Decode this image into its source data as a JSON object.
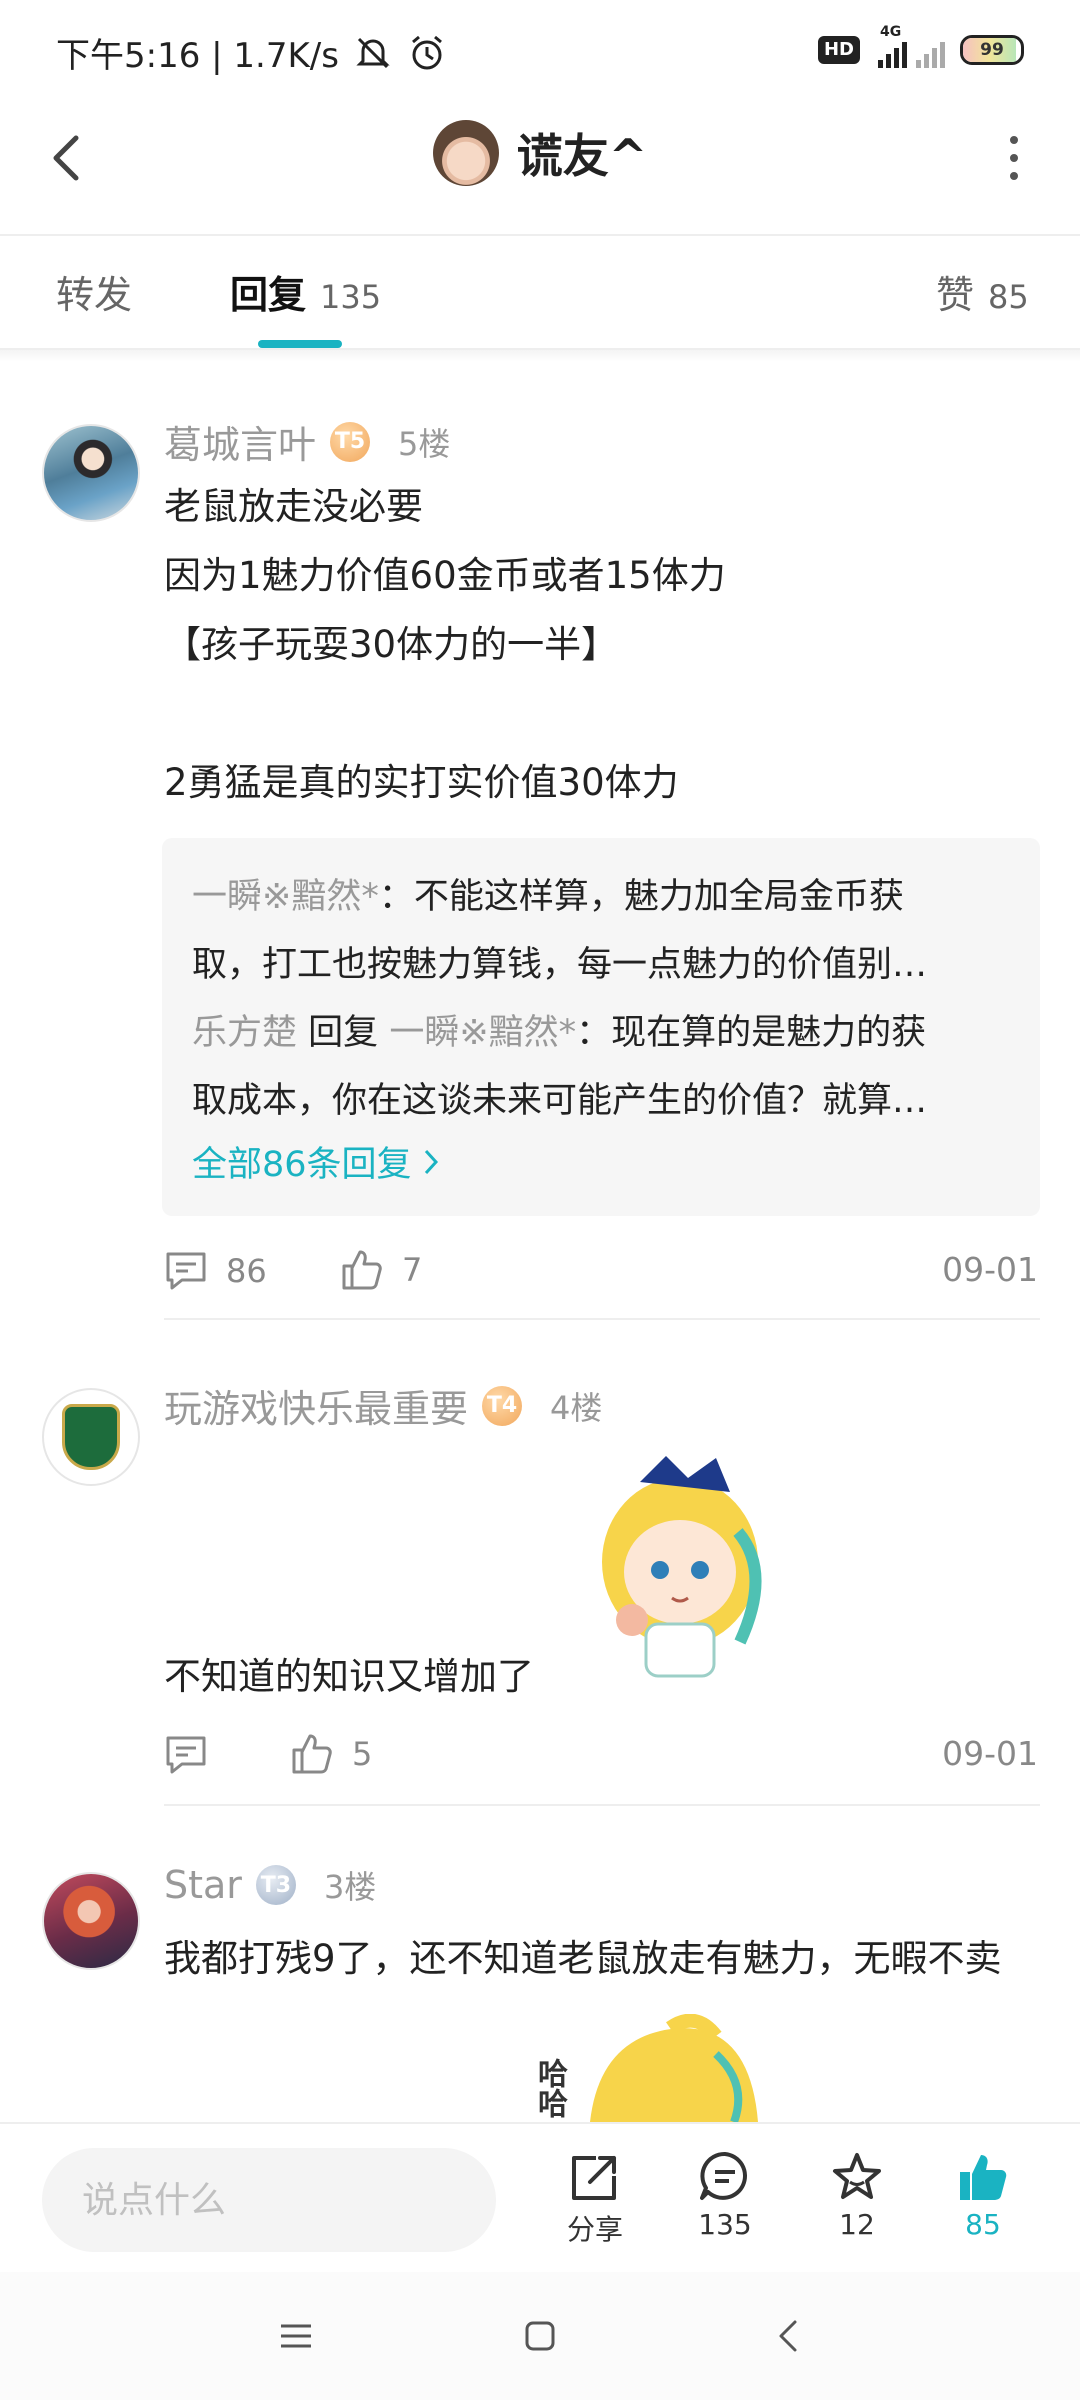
{
  "status_bar": {
    "time_speed": "下午5:16 | 1.7K/s",
    "hd": "HD",
    "network": "4G",
    "battery": "99"
  },
  "header": {
    "title": "谎友^"
  },
  "tabs": {
    "forward": "转发",
    "reply": "回复",
    "reply_count": "135",
    "like": "赞",
    "like_count": "85"
  },
  "posts": [
    {
      "username": "葛城言叶",
      "level": "T5",
      "floor": "5楼",
      "lines": [
        "老鼠放走没必要",
        "因为1魅力价值60金币或者15体力",
        "【孩子玩耍30体力的一半】",
        "",
        "2勇猛是真的实打实价值30体力"
      ],
      "replies": {
        "r1_user": "一瞬※黯然*",
        "r1_line1": "：不能这样算，魅力加全局金币获",
        "r1_line2": "取，打工也按魅力算钱，每一点魅力的价值别…",
        "r2_user": "乐方楚",
        "r2_mid": "回复",
        "r2_target": "一瞬※黯然*",
        "r2_line1": "：现在算的是魅力的获",
        "r2_line2": "取成本，你在这谈未来可能产生的价值？就算…",
        "all_label": "全部86条回复"
      },
      "comments": "86",
      "likes": "7",
      "date": "09-01"
    },
    {
      "username": "玩游戏快乐最重要",
      "level": "T4",
      "floor": "4楼",
      "text": "不知道的知识又增加了",
      "comments": "",
      "likes": "5",
      "date": "09-01"
    },
    {
      "username": "Star",
      "level": "T3",
      "floor": "3楼",
      "text": "我都打残9了，还不知道老鼠放走有魅力，无暇不卖",
      "sticker_text": "哈哈"
    }
  ],
  "bottom_bar": {
    "placeholder": "说点什么",
    "share": "分享",
    "comments": "135",
    "favorites": "12",
    "likes": "85"
  },
  "colors": {
    "accent": "#1ab3c2",
    "muted": "#999999",
    "text": "#222222"
  },
  "icons": [
    "mute-icon",
    "alarm-icon",
    "back-icon",
    "more-icon",
    "comment-icon",
    "thumb-up-icon",
    "share-icon",
    "star-icon",
    "menu-icon",
    "home-icon",
    "nav-back-icon"
  ]
}
